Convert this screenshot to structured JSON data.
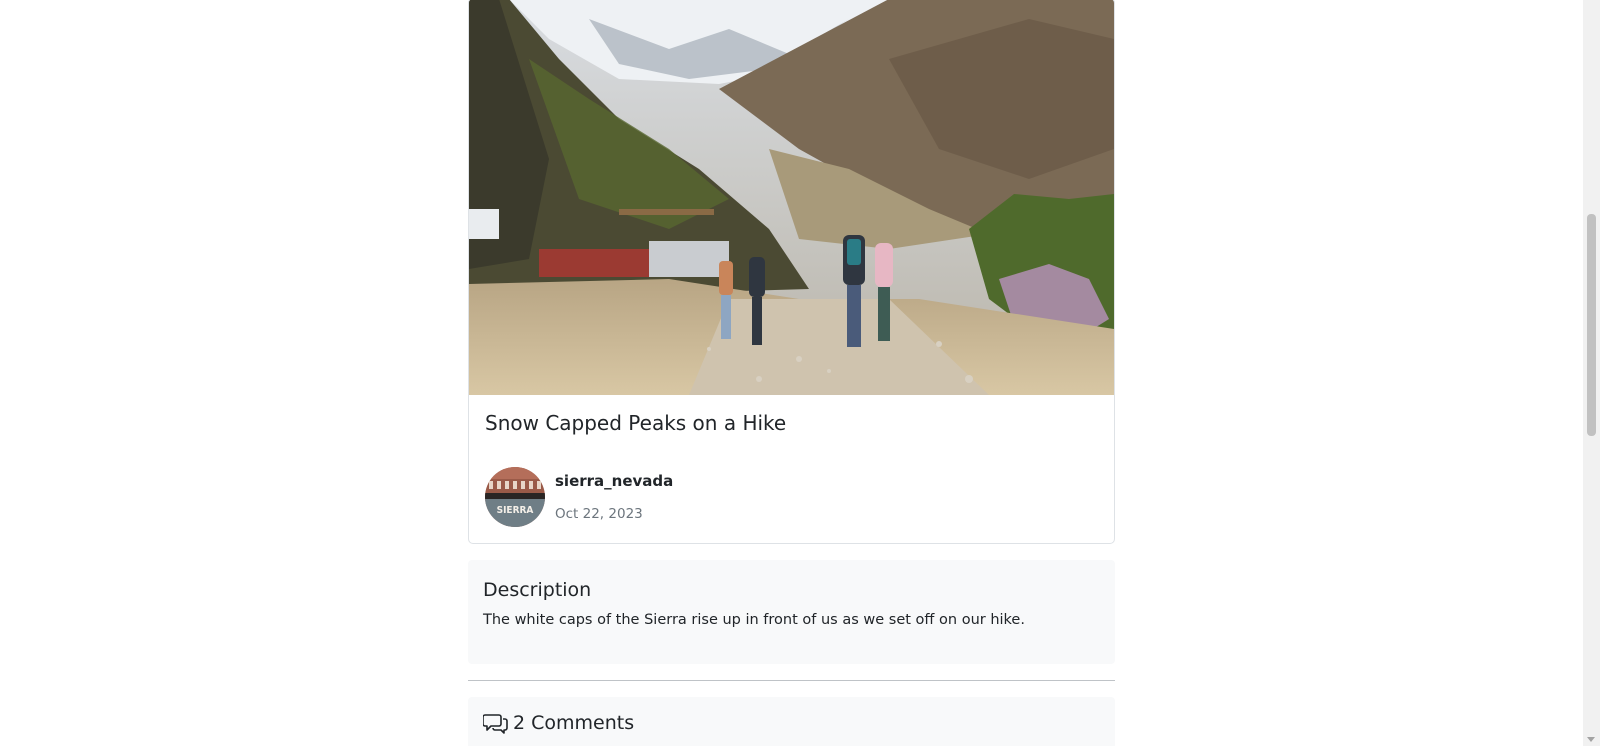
{
  "post": {
    "title": "Snow Capped Peaks on a Hike",
    "photo_alt": "Hikers walking a rocky trail toward snow capped mountains",
    "author": {
      "username": "sierra_nevada",
      "date": "Oct 22, 2023",
      "avatar_text": "SIERRA"
    }
  },
  "description": {
    "heading": "Description",
    "text": "The white caps of the Sierra rise up in front of us as we set off on our hike."
  },
  "comments": {
    "heading": "2 Comments",
    "icon": "chat-bubbles-icon"
  },
  "colors": {
    "panel_bg": "#f8f9fa",
    "muted_text": "#6c757d",
    "border": "#dee2e6"
  }
}
